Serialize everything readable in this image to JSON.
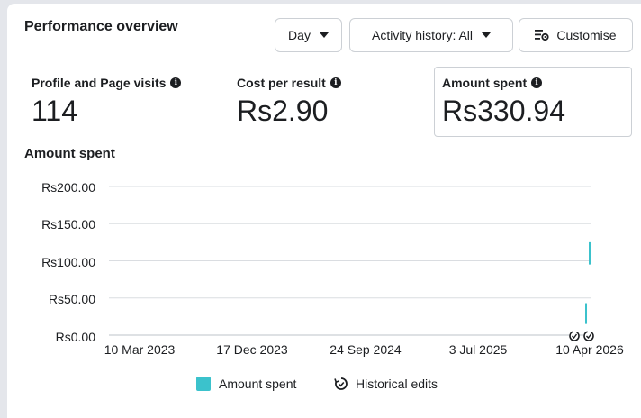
{
  "header": {
    "title": "Performance overview",
    "day_button": "Day",
    "activity_button": "Activity history: All",
    "customise_button": "Customise"
  },
  "metrics": [
    {
      "label": "Profile and Page visits",
      "value": "114"
    },
    {
      "label": "Cost per result",
      "value": "Rs2.90"
    },
    {
      "label": "Amount spent",
      "value": "Rs330.94",
      "selected": true
    }
  ],
  "chart_section": {
    "title": "Amount spent"
  },
  "chart_data": {
    "type": "bar",
    "ylabel": "",
    "xlabel": "",
    "ylim": [
      0,
      200
    ],
    "y_ticks": [
      "Rs200.00",
      "Rs150.00",
      "Rs100.00",
      "Rs50.00",
      "Rs0.00"
    ],
    "y_tick_values": [
      200,
      150,
      100,
      50,
      0
    ],
    "x_ticks": [
      "10 Mar 2023",
      "17 Dec 2023",
      "24 Sep 2024",
      "3 Jul 2025",
      "10 Apr 2026"
    ],
    "series": [
      {
        "name": "Amount spent",
        "color": "#3bc2cc",
        "points": [
          {
            "x": "2026-04-01",
            "y": [
              15,
              43
            ]
          },
          {
            "x": "2026-04-10",
            "y": [
              95,
              125
            ]
          }
        ]
      }
    ],
    "historical_edit_markers": 2,
    "grid": true
  },
  "legend": {
    "series_label": "Amount spent",
    "series_color": "#3bc2cc",
    "edits_label": "Historical edits"
  }
}
